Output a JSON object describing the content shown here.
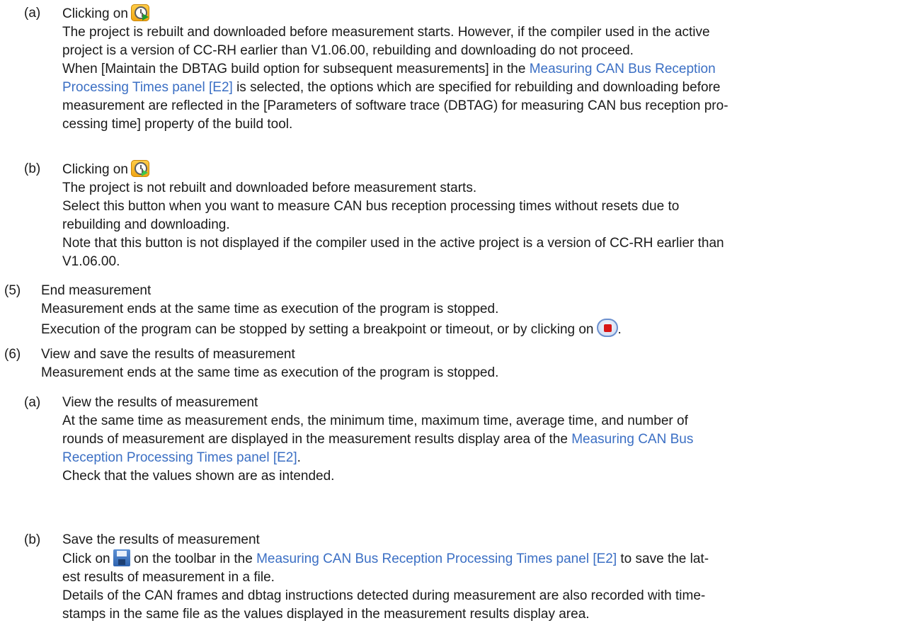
{
  "items": {
    "a1": {
      "label": "(a)",
      "heading": "Clicking on",
      "icon": "start-measurement-with-rebuild-icon",
      "lines": [
        "The project is rebuilt and downloaded before measurement starts. However, if the compiler used in the active",
        "project is a version of CC-RH earlier than V1.06.00, rebuilding and downloading do not proceed."
      ],
      "line3_before": "When [Maintain the DBTAG build option for subsequent measurements] in the ",
      "line3_link": "Measuring CAN Bus Reception",
      "line4_link": "Processing Times panel [E2]",
      "line4_after": " is selected, the options which are specified for rebuilding and downloading before",
      "line5": "measurement are reflected in the [Parameters of software trace (DBTAG) for measuring CAN bus reception pro-",
      "line6": "cessing time] property of the build tool."
    },
    "b1": {
      "label": "(b)",
      "heading": "Clicking on",
      "icon": "start-measurement-without-rebuild-icon",
      "lines": [
        "The project is not rebuilt and downloaded before measurement starts.",
        "Select this button when you want to measure CAN bus reception processing times without resets due to",
        "rebuilding and downloading.",
        "Note that this button is not displayed if the compiler used in the active project is a version of CC-RH earlier than",
        "V1.06.00."
      ]
    },
    "s5": {
      "label": "(5)",
      "heading": "End measurement",
      "line1": "Measurement ends at the same time as execution of the program is stopped.",
      "line2": "Execution of the program can be stopped by setting a breakpoint or timeout, or by clicking on",
      "line2_end": ".",
      "icon": "stop-icon"
    },
    "s6": {
      "label": "(6)",
      "heading": "View and save the results of measurement",
      "line1": "Measurement ends at the same time as execution of the program is stopped."
    },
    "a2": {
      "label": "(a)",
      "heading": "View the results of measurement",
      "line1": "At the same time as measurement ends, the minimum time, maximum time, average time, and number of",
      "line2_before": "rounds of measurement are displayed in the measurement results display area of the ",
      "line2_link": "Measuring CAN Bus",
      "line3_link": "Reception Processing Times panel [E2]",
      "line3_after": ".",
      "line4": "Check that the values shown are as intended."
    },
    "b2": {
      "label": "(b)",
      "heading": "Save the results of measurement",
      "line1_before": "Click on",
      "icon": "save-icon",
      "line1_mid": " on the toolbar in the ",
      "line1_link": "Measuring CAN Bus Reception Processing Times panel [E2]",
      "line1_after": " to save the lat-",
      "line2": "est results of measurement in a file.",
      "line3": "Details of the CAN frames and dbtag instructions detected during measurement are also recorded with time-",
      "line4": "stamps in the same file as the values displayed in the measurement results display area."
    }
  },
  "colors": {
    "link": "#3b6fc4",
    "text": "#1a1a1a"
  }
}
